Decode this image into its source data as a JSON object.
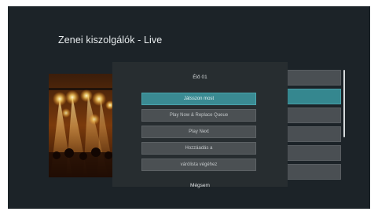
{
  "page": {
    "title": "Zenei kiszolgálók - Live"
  },
  "album_art": {
    "description": "concert-stage-photo"
  },
  "tiles": {
    "count": 6,
    "selected_index": 1
  },
  "dialog": {
    "title": "Élő 01",
    "menu_items": [
      {
        "label": "Játsszon most",
        "focused": true
      },
      {
        "label": "Play Now & Replace Queue",
        "focused": false
      },
      {
        "label": "Play Next",
        "focused": false
      },
      {
        "label": "Hozzáadás a",
        "focused": false
      },
      {
        "label": "várólista végéhez",
        "focused": false
      }
    ],
    "cancel_label": "Mégsem"
  },
  "colors": {
    "background": "#1c2328",
    "dialog": "#272d30",
    "accent": "#3a8a92",
    "menu_item": "#4b5053",
    "tile": "#4a4f53"
  }
}
